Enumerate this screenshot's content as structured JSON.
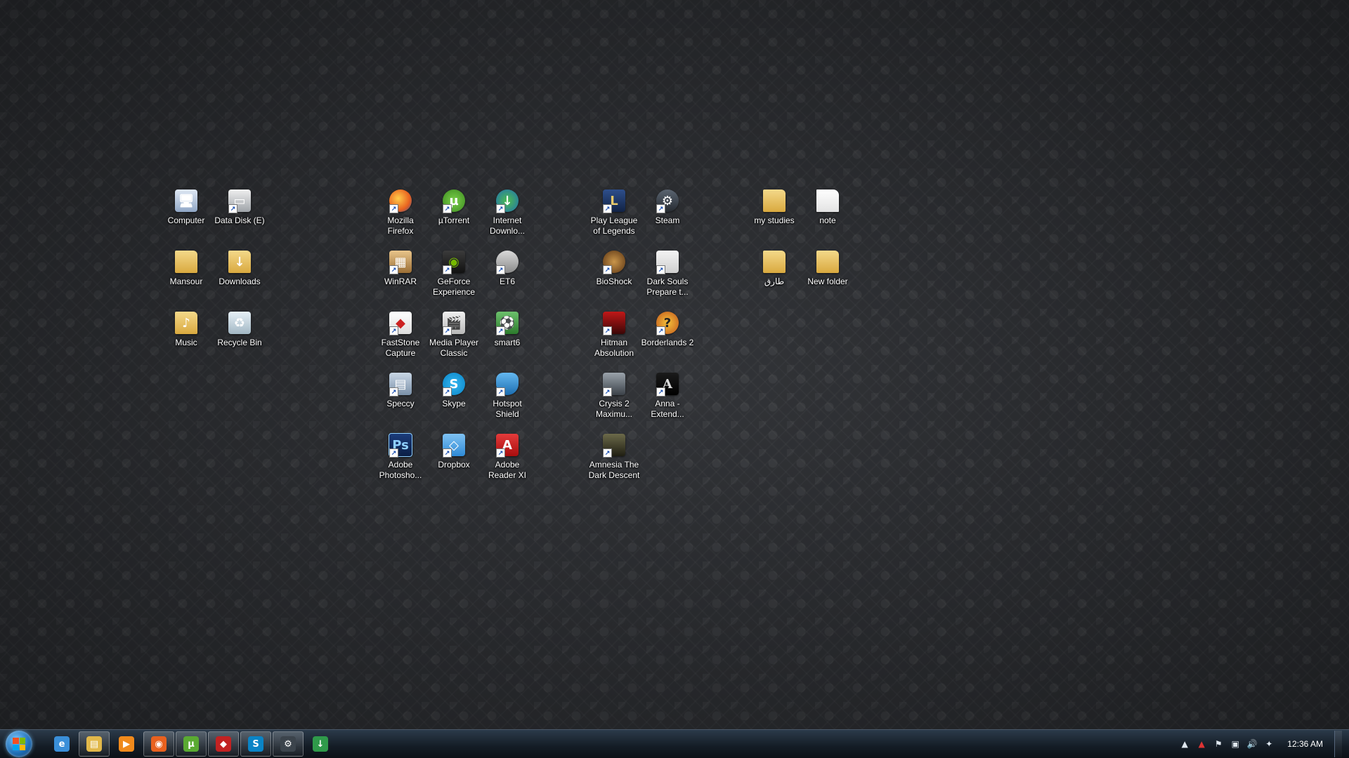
{
  "desktop": {
    "icons": [
      {
        "id": "computer",
        "label": "Computer",
        "glyph": "🖥",
        "cls": "computer",
        "shortcut": false
      },
      {
        "id": "data-disk",
        "label": "Data Disk (E)",
        "glyph": "▭",
        "cls": "disk",
        "shortcut": true
      },
      {
        "id": "mansour",
        "label": "Mansour",
        "glyph": "",
        "cls": "folder",
        "shortcut": false
      },
      {
        "id": "downloads",
        "label": "Downloads",
        "glyph": "↓",
        "cls": "folder",
        "shortcut": false
      },
      {
        "id": "music",
        "label": "Music",
        "glyph": "♪",
        "cls": "folder",
        "shortcut": false
      },
      {
        "id": "recycle-bin",
        "label": "Recycle Bin",
        "glyph": "♻",
        "cls": "recycle",
        "shortcut": false
      },
      {
        "id": "firefox",
        "label": "Mozilla\nFirefox",
        "glyph": "",
        "cls": "firefox",
        "shortcut": true
      },
      {
        "id": "utorrent",
        "label": "µTorrent",
        "glyph": "µ",
        "cls": "utorrent",
        "shortcut": true
      },
      {
        "id": "idm",
        "label": "Internet\nDownlo...",
        "glyph": "↓",
        "cls": "idm",
        "shortcut": true
      },
      {
        "id": "winrar",
        "label": "WinRAR",
        "glyph": "▦",
        "cls": "winrar",
        "shortcut": true
      },
      {
        "id": "geforce",
        "label": "GeForce\nExperience",
        "glyph": "◉",
        "cls": "geforce",
        "shortcut": true
      },
      {
        "id": "et6",
        "label": "ET6",
        "glyph": "",
        "cls": "et6",
        "shortcut": true
      },
      {
        "id": "faststone",
        "label": "FastStone\nCapture",
        "glyph": "◆",
        "cls": "faststone",
        "shortcut": true
      },
      {
        "id": "mpc",
        "label": "Media Player\nClassic",
        "glyph": "🎬",
        "cls": "mpc",
        "shortcut": true
      },
      {
        "id": "smart6",
        "label": "smart6",
        "glyph": "⚽",
        "cls": "smart6",
        "shortcut": true
      },
      {
        "id": "speccy",
        "label": "Speccy",
        "glyph": "▤",
        "cls": "speccy",
        "shortcut": true
      },
      {
        "id": "skype",
        "label": "Skype",
        "glyph": "S",
        "cls": "skype",
        "shortcut": true
      },
      {
        "id": "hotspot",
        "label": "Hotspot\nShield",
        "glyph": "",
        "cls": "hotspot",
        "shortcut": true
      },
      {
        "id": "photoshop",
        "label": "Adobe\nPhotosho...",
        "glyph": "Ps",
        "cls": "photoshop",
        "shortcut": true
      },
      {
        "id": "dropbox",
        "label": "Dropbox",
        "glyph": "◇",
        "cls": "dropbox",
        "shortcut": true
      },
      {
        "id": "adobe-reader",
        "label": "Adobe\nReader XI",
        "glyph": "A",
        "cls": "adobe",
        "shortcut": true
      },
      {
        "id": "league",
        "label": "Play League\nof Legends",
        "glyph": "L",
        "cls": "league",
        "shortcut": true
      },
      {
        "id": "steam",
        "label": "Steam",
        "glyph": "⚙",
        "cls": "steam",
        "shortcut": true
      },
      {
        "id": "bioshock",
        "label": "BioShock",
        "glyph": "",
        "cls": "bioshock",
        "shortcut": true
      },
      {
        "id": "darksouls",
        "label": "Dark Souls\nPrepare t...",
        "glyph": "",
        "cls": "darksouls",
        "shortcut": true
      },
      {
        "id": "hitman",
        "label": "Hitman\nAbsolution",
        "glyph": "",
        "cls": "hitman",
        "shortcut": true
      },
      {
        "id": "borderlands",
        "label": "Borderlands 2",
        "glyph": "?",
        "cls": "borderlands",
        "shortcut": true
      },
      {
        "id": "crysis",
        "label": "Crysis 2\nMaximu...",
        "glyph": "",
        "cls": "crysis",
        "shortcut": true
      },
      {
        "id": "anna",
        "label": "Anna -\nExtend...",
        "glyph": "A",
        "cls": "anna",
        "shortcut": true
      },
      {
        "id": "amnesia",
        "label": "Amnesia The\nDark Descent",
        "glyph": "",
        "cls": "amnesia",
        "shortcut": true
      },
      {
        "id": "my-studies",
        "label": "my studies",
        "glyph": "",
        "cls": "folder",
        "shortcut": false
      },
      {
        "id": "note",
        "label": "note",
        "glyph": "",
        "cls": "textfile",
        "shortcut": false
      },
      {
        "id": "tariq",
        "label": "طارق",
        "glyph": "",
        "cls": "folder",
        "shortcut": false
      },
      {
        "id": "new-folder",
        "label": "New folder",
        "glyph": "",
        "cls": "folder",
        "shortcut": false
      }
    ]
  },
  "taskbar": {
    "buttons": [
      {
        "id": "ie",
        "glyph": "e",
        "color": "#3a8fd9",
        "active": false
      },
      {
        "id": "explorer",
        "glyph": "▤",
        "color": "#e2b84a",
        "active": true
      },
      {
        "id": "media-player",
        "glyph": "▶",
        "color": "#f08a1c",
        "active": false
      },
      {
        "id": "firefox",
        "glyph": "◉",
        "color": "#e8611f",
        "active": true
      },
      {
        "id": "utorrent",
        "glyph": "µ",
        "color": "#5aaa32",
        "active": true
      },
      {
        "id": "faststone",
        "glyph": "◆",
        "color": "#c22222",
        "active": true
      },
      {
        "id": "skype",
        "glyph": "S",
        "color": "#0a84c6",
        "active": true
      },
      {
        "id": "steam",
        "glyph": "⚙",
        "color": "#3c444c",
        "active": true
      },
      {
        "id": "idm",
        "glyph": "↓",
        "color": "#2f9a4a",
        "active": false
      }
    ],
    "tray": {
      "icons": [
        {
          "id": "show-hidden",
          "glyph": "▲"
        },
        {
          "id": "network-activity",
          "glyph": "▲"
        },
        {
          "id": "action-center",
          "glyph": "⚑"
        },
        {
          "id": "network",
          "glyph": "▣"
        },
        {
          "id": "volume",
          "glyph": "🔊"
        },
        {
          "id": "dropbox-tray",
          "glyph": "✦"
        }
      ],
      "clock": "12:36 AM"
    }
  }
}
